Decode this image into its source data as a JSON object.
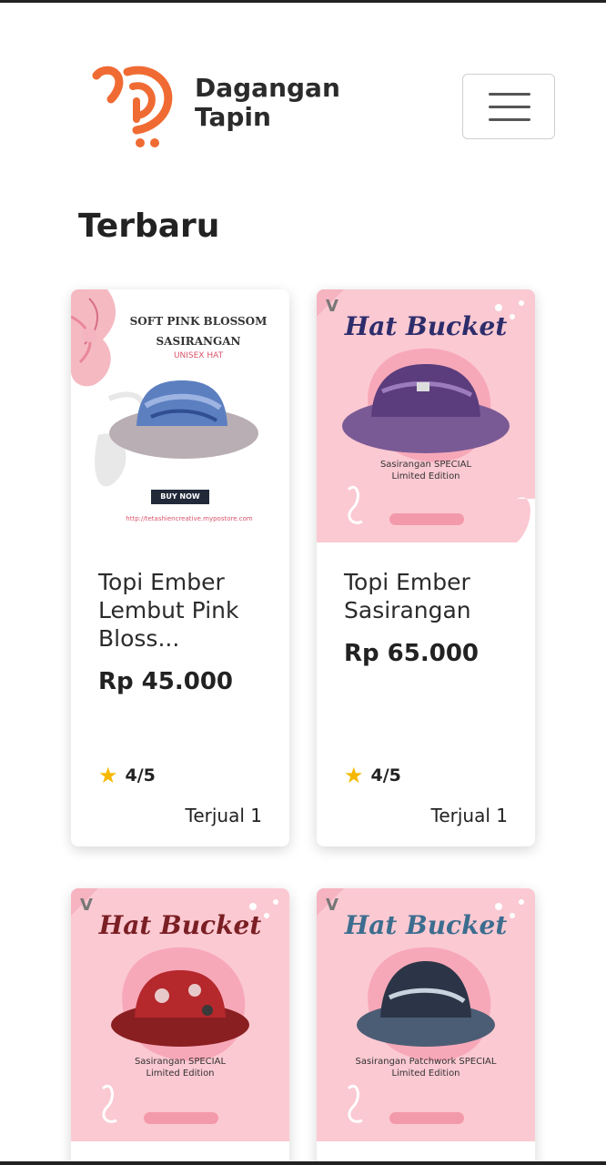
{
  "header": {
    "brand_line1": "Dagangan",
    "brand_line2": "Tapin",
    "logo_icon": "shopping-cart-d-logo",
    "menu_icon": "hamburger-menu-icon",
    "accent_color": "#ef6b33"
  },
  "section": {
    "title": "Terbaru"
  },
  "products": [
    {
      "name": "Topi Ember Lembut Pink Bloss...",
      "price": "Rp 45.000",
      "rating": "4/5",
      "sold": "Terjual 1",
      "image_text": {
        "line1": "SOFT PINK BLOSSOM",
        "line2": "SASIRANGAN",
        "line3": "UNISEX HAT",
        "button": "BUY NOW",
        "url": "http://tetashiencreative.mypostore.com"
      }
    },
    {
      "name": "Topi Ember Sasirangan",
      "price": "Rp 65.000",
      "rating": "4/5",
      "sold": "Terjual 1",
      "image_text": {
        "title": "Hat Bucket",
        "caption": "Sasirangan SPECIAL Limited Edition"
      }
    },
    {
      "image_text": {
        "title": "Hat Bucket",
        "caption": "Sasirangan SPECIAL Limited Edition"
      }
    },
    {
      "image_text": {
        "title": "Hat Bucket",
        "caption": "Sasirangan Patchwork SPECIAL Limited Edition"
      }
    }
  ]
}
